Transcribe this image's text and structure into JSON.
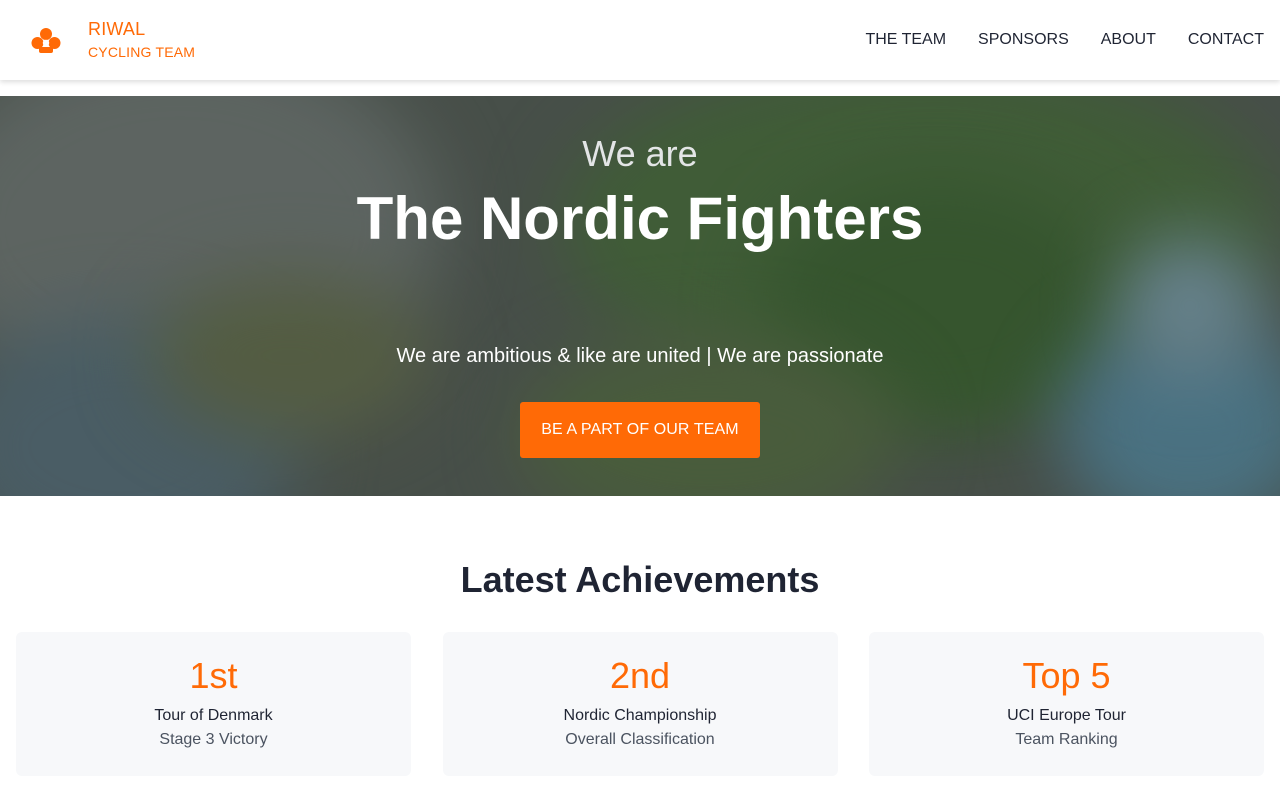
{
  "header": {
    "brand_name": "RIWAL",
    "brand_sub": "CYCLING TEAM",
    "logo_icon": "cyclists-logo-icon",
    "nav": [
      {
        "label": "THE TEAM"
      },
      {
        "label": "SPONSORS"
      },
      {
        "label": "ABOUT"
      },
      {
        "label": "CONTACT"
      }
    ]
  },
  "hero": {
    "pre_title": "We are",
    "title": "The Nordic Fighters",
    "tagline": "We are ambitious & like are united | We are passionate",
    "cta_label": "BE A PART OF OUR TEAM",
    "background": "blurred photo of cyclist helmet with green foliage"
  },
  "achievements": {
    "title": "Latest Achievements",
    "cards": [
      {
        "rank": "1st",
        "event": "Tour of Denmark",
        "detail": "Stage 3 Victory"
      },
      {
        "rank": "2nd",
        "event": "Nordic Championship",
        "detail": "Overall Classification"
      },
      {
        "rank": "Top 5",
        "event": "UCI Europe Tour",
        "detail": "Team Ranking"
      }
    ]
  },
  "colors": {
    "accent": "#ff6a06",
    "text_dark": "#1f2433",
    "text_muted": "#4b5360",
    "card_bg": "#f7f8fa"
  }
}
